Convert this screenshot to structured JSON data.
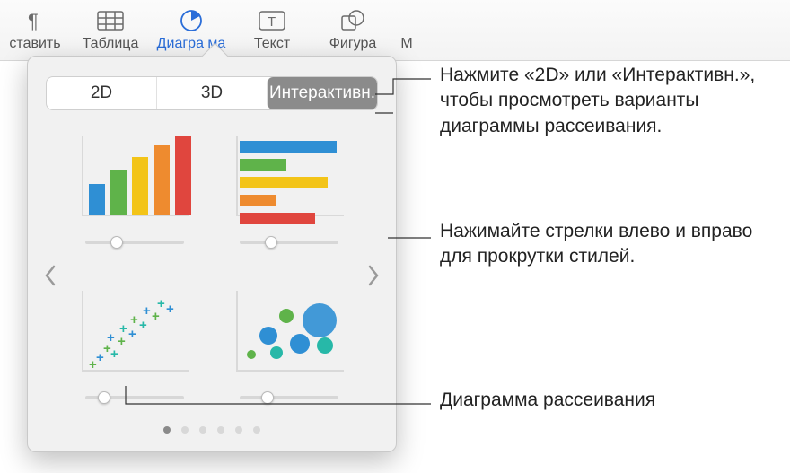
{
  "toolbar": {
    "items": [
      {
        "label": "ставить"
      },
      {
        "label": "Таблица"
      },
      {
        "label": "Диагра   ма",
        "active": true
      },
      {
        "label": "Текст"
      },
      {
        "label": "Фигура"
      },
      {
        "label": "М"
      }
    ]
  },
  "popover": {
    "tabs": {
      "t0": "2D",
      "t1": "3D",
      "t2": "Интерактивн."
    },
    "pages": 6,
    "activePage": 0
  },
  "callouts": {
    "c1": "Нажмите «2D» или «Интерактивн.», чтобы просмотреть варианты диаграммы рассеивания.",
    "c2": "Нажимайте стрелки влево и вправо для прокрутки стилей.",
    "c3": "Диаграмма рассеивания"
  },
  "colors": {
    "blue": "#2F8FD4",
    "green": "#5FB34A",
    "yellow": "#F3C418",
    "orange": "#EE8B2F",
    "red": "#E0463E",
    "teal": "#27B8A8"
  }
}
